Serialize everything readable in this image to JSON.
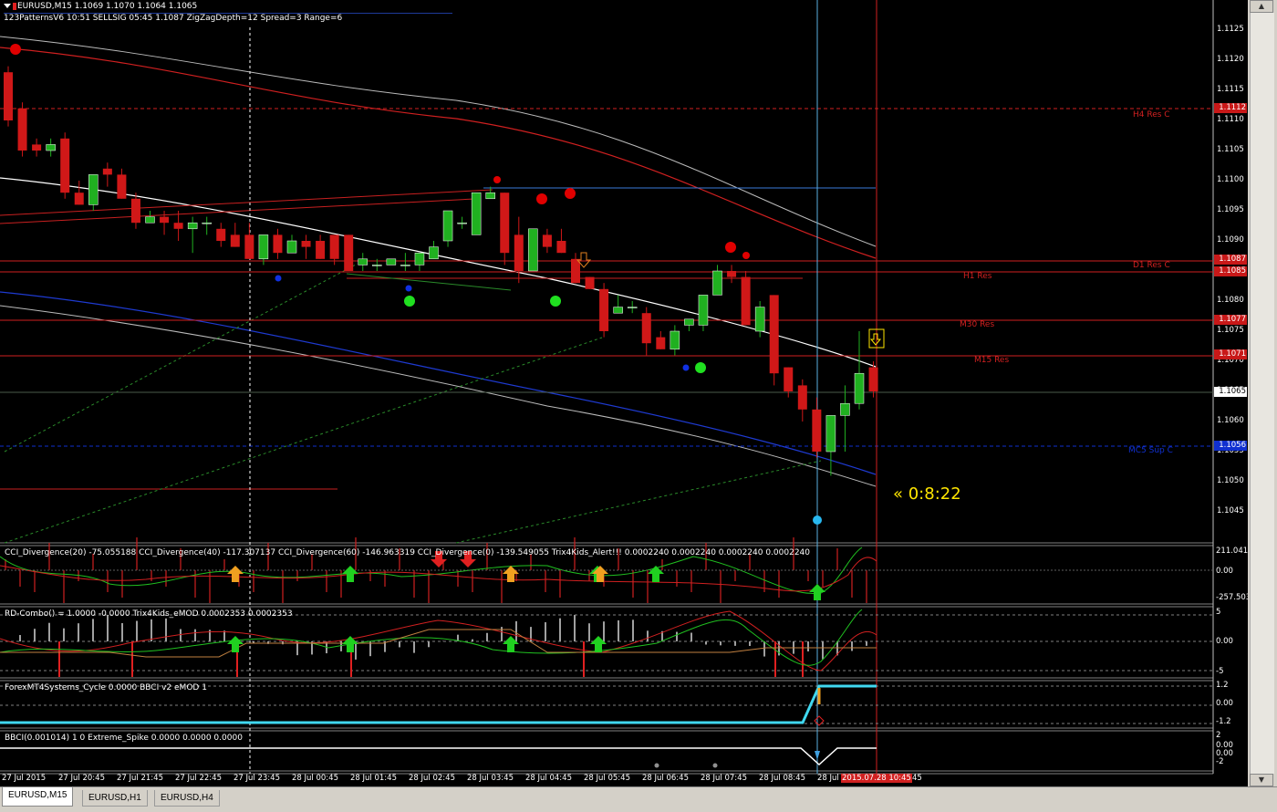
{
  "header": {
    "symbol_line": "EURUSD,M15  1.1069 1.1070 1.1064 1.1065",
    "indicator_line": "123PatternsV6  10:51  SELLSIG  05:45  1.1087  ZigZagDepth=12  Spread=3  Range=6"
  },
  "price_axis": {
    "ticks": [
      "1.1125",
      "1.1120",
      "1.1115",
      "1.1110",
      "1.1105",
      "1.1100",
      "1.1095",
      "1.1090",
      "1.1080",
      "1.1075",
      "1.1070",
      "1.1065",
      "1.1060",
      "1.1055",
      "1.1050",
      "1.1045"
    ],
    "badges": [
      {
        "text": "1.1112",
        "color": "#c81818"
      },
      {
        "text": "1.1087",
        "color": "#c81818"
      },
      {
        "text": "1.1085",
        "color": "#c81818"
      },
      {
        "text": "1.1077",
        "color": "#c81818"
      },
      {
        "text": "1.1071",
        "color": "#c81818"
      },
      {
        "text": "1.1065",
        "color": "#ffffff"
      },
      {
        "text": "1.1056",
        "color": "#1030d0"
      }
    ]
  },
  "levels": {
    "h4": "H4 Res C",
    "d1": "D1 Res C",
    "h1": "H1 Res",
    "m30": "M30 Res",
    "m15": "M15 Res",
    "blue": "MC5 Sup C"
  },
  "countdown": "« 0:8:22",
  "sub1": {
    "label": "CCI_Divergence(20) -75.055188  CCI_Divergence(40) -117.307137  CCI_Divergence(60) -146.963319  CCI_Divergence(0) -139.549055  Trix4Kids_Alert!!! 0.0002240 0.0002240 0.0002240 0.0002240",
    "top": "211.0410",
    "mid": "0.00",
    "bottom": "-257.503"
  },
  "sub2": {
    "label": "RD-Combo() = 1.0000 -0.0000  Trix4Kids_eMOD 0.0002353 0.0002353",
    "top": "5",
    "mid": "0.00",
    "bottom": "-5"
  },
  "sub3": {
    "label": "ForexMT4Systems_Cycle 0.0000  BBCI v2 eMOD 1",
    "top": "1.2",
    "mid": "0.00",
    "bottom": "-1.2"
  },
  "sub4": {
    "label": "BBCI(0.001014) 1 0  Extreme_Spike 0.0000 0.0000 0.0000",
    "top": "2",
    "mid1": "0.00",
    "mid2": "0.00",
    "bottom": "-2"
  },
  "time_axis": [
    "27 Jul 2015",
    "27 Jul 20:45",
    "27 Jul 21:45",
    "27 Jul 22:45",
    "27 Jul 23:45",
    "28 Jul 00:45",
    "28 Jul 01:45",
    "28 Jul 02:45",
    "28 Jul 03:45",
    "28 Jul 04:45",
    "28 Jul 05:45",
    "28 Jul 06:45",
    "28 Jul 07:45",
    "28 Jul 08:45",
    "28 Jul"
  ],
  "time_axis_last": "45",
  "time_axis_highlight": "2015.07.28 10:45",
  "tabs": [
    "EURUSD,M15",
    "EURUSD,H1",
    "EURUSD,H4"
  ],
  "candles": [
    [
      1.1118,
      1.1119,
      1.1109,
      1.111
    ],
    [
      1.1112,
      1.1113,
      1.1104,
      1.1105
    ],
    [
      1.1106,
      1.1107,
      1.1104,
      1.1105
    ],
    [
      1.1105,
      1.1107,
      1.1104,
      1.1106
    ],
    [
      1.1107,
      1.1108,
      1.1097,
      1.1098
    ],
    [
      1.1098,
      1.11,
      1.1096,
      1.1096
    ],
    [
      1.1096,
      1.1101,
      1.1095,
      1.1101
    ],
    [
      1.1102,
      1.1103,
      1.1099,
      1.1101
    ],
    [
      1.1101,
      1.1102,
      1.1097,
      1.1097
    ],
    [
      1.1097,
      1.1098,
      1.1092,
      1.1093
    ],
    [
      1.1093,
      1.1095,
      1.1093,
      1.1094
    ],
    [
      1.1094,
      1.1095,
      1.1091,
      1.1093
    ],
    [
      1.1093,
      1.1095,
      1.109,
      1.1092
    ],
    [
      1.1092,
      1.1094,
      1.1088,
      1.1093
    ],
    [
      1.1093,
      1.1094,
      1.1091,
      1.1093
    ],
    [
      1.1092,
      1.1093,
      1.1089,
      1.109
    ],
    [
      1.1091,
      1.1093,
      1.1089,
      1.1089
    ],
    [
      1.1091,
      1.1093,
      1.1087,
      1.1087
    ],
    [
      1.1087,
      1.1091,
      1.1086,
      1.1091
    ],
    [
      1.1091,
      1.1092,
      1.1087,
      1.1088
    ],
    [
      1.1088,
      1.1091,
      1.1088,
      1.109
    ],
    [
      1.109,
      1.1091,
      1.1087,
      1.1089
    ],
    [
      1.109,
      1.1091,
      1.1087,
      1.1087
    ],
    [
      1.1091,
      1.1091,
      1.1086,
      1.1087
    ],
    [
      1.1091,
      1.1091,
      1.1085,
      1.1085
    ],
    [
      1.1086,
      1.1088,
      1.1085,
      1.1087
    ],
    [
      1.1086,
      1.1087,
      1.1085,
      1.1086
    ],
    [
      1.1086,
      1.1087,
      1.1086,
      1.1087
    ],
    [
      1.1086,
      1.1088,
      1.1085,
      1.1086
    ],
    [
      1.1086,
      1.1088,
      1.1085,
      1.1088
    ],
    [
      1.1087,
      1.109,
      1.1087,
      1.1089
    ],
    [
      1.109,
      1.1095,
      1.1089,
      1.1095
    ],
    [
      1.1093,
      1.1094,
      1.1092,
      1.1093
    ],
    [
      1.1091,
      1.1098,
      1.1091,
      1.1098
    ],
    [
      1.1097,
      1.1099,
      1.1097,
      1.1098
    ],
    [
      1.1098,
      1.1098,
      1.1086,
      1.1088
    ],
    [
      1.1091,
      1.1094,
      1.1083,
      1.1085
    ],
    [
      1.1085,
      1.1092,
      1.1085,
      1.1092
    ],
    [
      1.1091,
      1.1092,
      1.1088,
      1.1089
    ],
    [
      1.109,
      1.1092,
      1.1088,
      1.1088
    ],
    [
      1.1087,
      1.1088,
      1.1083,
      1.1083
    ],
    [
      1.1084,
      1.1084,
      1.1082,
      1.1082
    ],
    [
      1.1082,
      1.1083,
      1.1074,
      1.1075
    ],
    [
      1.1078,
      1.1081,
      1.1078,
      1.1079
    ],
    [
      1.1079,
      1.108,
      1.1078,
      1.1079
    ],
    [
      1.1078,
      1.1079,
      1.1071,
      1.1073
    ],
    [
      1.1074,
      1.1075,
      1.1072,
      1.1072
    ],
    [
      1.1072,
      1.1076,
      1.1071,
      1.1075
    ],
    [
      1.1076,
      1.1077,
      1.1075,
      1.1077
    ],
    [
      1.1076,
      1.1081,
      1.1075,
      1.1081
    ],
    [
      1.1081,
      1.1086,
      1.1081,
      1.1085
    ],
    [
      1.1085,
      1.1086,
      1.1083,
      1.1084
    ],
    [
      1.1084,
      1.1085,
      1.1076,
      1.1076
    ],
    [
      1.1075,
      1.108,
      1.1074,
      1.1079
    ],
    [
      1.1081,
      1.1081,
      1.1066,
      1.1068
    ],
    [
      1.1069,
      1.1069,
      1.1064,
      1.1065
    ],
    [
      1.1066,
      1.1067,
      1.106,
      1.1062
    ],
    [
      1.1062,
      1.1064,
      1.1054,
      1.1055
    ],
    [
      1.1055,
      1.1061,
      1.1051,
      1.1061
    ],
    [
      1.1061,
      1.1066,
      1.1055,
      1.1063
    ],
    [
      1.1063,
      1.1075,
      1.1062,
      1.1068
    ],
    [
      1.1069,
      1.107,
      1.1064,
      1.1065
    ]
  ]
}
